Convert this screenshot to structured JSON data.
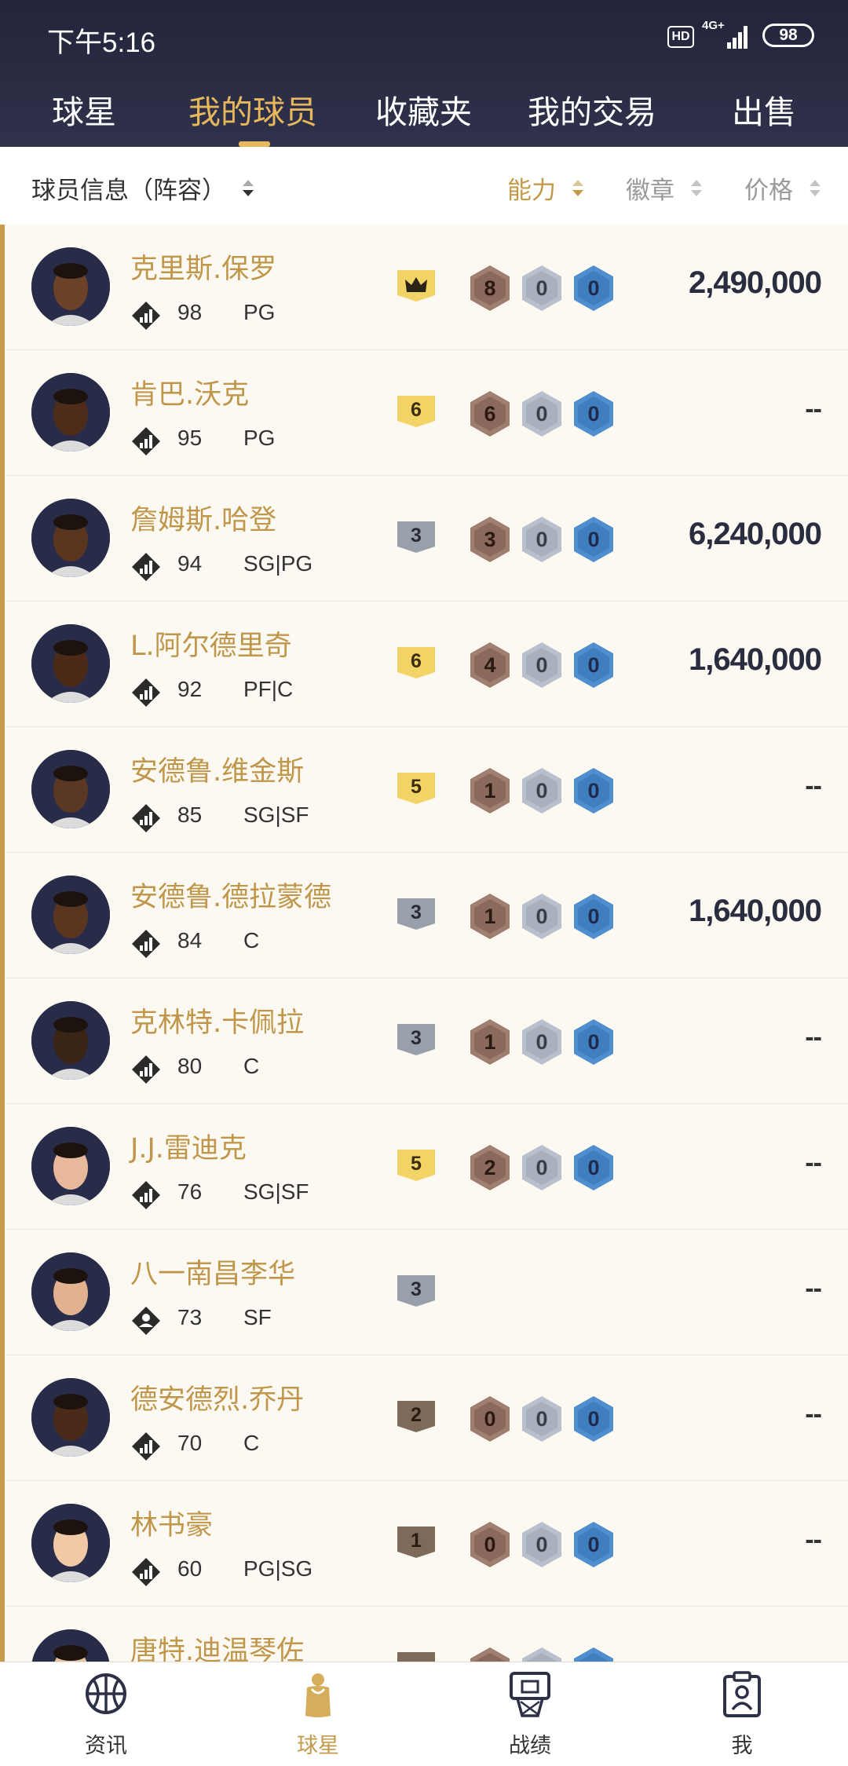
{
  "status_bar": {
    "time": "下午5:16",
    "hd": "HD",
    "network": "4G+",
    "battery": "98"
  },
  "top_tabs": [
    {
      "label": "球星",
      "active": false
    },
    {
      "label": "我的球员",
      "active": true
    },
    {
      "label": "收藏夹",
      "active": false
    },
    {
      "label": "我的交易",
      "active": false
    },
    {
      "label": "出售",
      "active": false
    }
  ],
  "sort_bar": {
    "lineup": "球员信息（阵容）",
    "ability": "能力",
    "badges": "徽章",
    "price": "价格"
  },
  "colors": {
    "accent_gold": "#c29a4a",
    "tab_active": "#e7b75c",
    "tier_gold": "#f2d365",
    "tier_silver": "#9aa0ab",
    "tier_bronze": "#7d6a5a",
    "badge_bronze": "#9e7f70",
    "badge_silver": "#b9c0cc",
    "badge_blue": "#4f8fd0"
  },
  "players": [
    {
      "name": "克里斯.保罗",
      "rating": "98",
      "position": "PG",
      "tier": "crown",
      "tier_color": "gold",
      "rank_icon": "signal-rank-icon",
      "badges": [
        "8",
        "0",
        "0"
      ],
      "price": "2,490,000"
    },
    {
      "name": "肯巴.沃克",
      "rating": "95",
      "position": "PG",
      "tier": "6",
      "tier_color": "gold",
      "rank_icon": "signal-rank-icon",
      "badges": [
        "6",
        "0",
        "0"
      ],
      "price": "--"
    },
    {
      "name": "詹姆斯.哈登",
      "rating": "94",
      "position": "SG|PG",
      "tier": "3",
      "tier_color": "silver",
      "rank_icon": "signal-rank-icon",
      "badges": [
        "3",
        "0",
        "0"
      ],
      "price": "6,240,000"
    },
    {
      "name": "L.阿尔德里奇",
      "rating": "92",
      "position": "PF|C",
      "tier": "6",
      "tier_color": "gold",
      "rank_icon": "signal-rank-icon",
      "badges": [
        "4",
        "0",
        "0"
      ],
      "price": "1,640,000"
    },
    {
      "name": "安德鲁.维金斯",
      "rating": "85",
      "position": "SG|SF",
      "tier": "5",
      "tier_color": "gold",
      "rank_icon": "signal-rank-icon",
      "badges": [
        "1",
        "0",
        "0"
      ],
      "price": "--"
    },
    {
      "name": "安德鲁.德拉蒙德",
      "rating": "84",
      "position": "C",
      "tier": "3",
      "tier_color": "silver",
      "rank_icon": "signal-rank-icon",
      "badges": [
        "1",
        "0",
        "0"
      ],
      "price": "1,640,000"
    },
    {
      "name": "克林特.卡佩拉",
      "rating": "80",
      "position": "C",
      "tier": "3",
      "tier_color": "silver",
      "rank_icon": "signal-rank-icon",
      "badges": [
        "1",
        "0",
        "0"
      ],
      "price": "--"
    },
    {
      "name": "J.J.雷迪克",
      "rating": "76",
      "position": "SG|SF",
      "tier": "5",
      "tier_color": "gold",
      "rank_icon": "signal-rank-icon",
      "badges": [
        "2",
        "0",
        "0"
      ],
      "price": "--"
    },
    {
      "name": "八一南昌李华",
      "rating": "73",
      "position": "SF",
      "tier": "3",
      "tier_color": "silver",
      "rank_icon": "person-rank-icon",
      "badges": [],
      "price": "--"
    },
    {
      "name": "德安德烈.乔丹",
      "rating": "70",
      "position": "C",
      "tier": "2",
      "tier_color": "bronze",
      "rank_icon": "signal-rank-icon",
      "badges": [
        "0",
        "0",
        "0"
      ],
      "price": "--"
    },
    {
      "name": "林书豪",
      "rating": "60",
      "position": "PG|SG",
      "tier": "1",
      "tier_color": "bronze",
      "rank_icon": "signal-rank-icon",
      "badges": [
        "0",
        "0",
        "0"
      ],
      "price": "--"
    },
    {
      "name": "唐特.迪温琴佐",
      "rating": "",
      "position": "",
      "tier": "",
      "tier_color": "bronze",
      "rank_icon": "signal-rank-icon",
      "badges": [
        "",
        "",
        ""
      ],
      "price": ""
    }
  ],
  "bottom_nav": [
    {
      "label": "资讯",
      "icon": "basketball-icon",
      "active": false
    },
    {
      "label": "球星",
      "icon": "player-jersey-icon",
      "active": true
    },
    {
      "label": "战绩",
      "icon": "hoop-icon",
      "active": false
    },
    {
      "label": "我",
      "icon": "clipboard-user-icon",
      "active": false
    }
  ]
}
